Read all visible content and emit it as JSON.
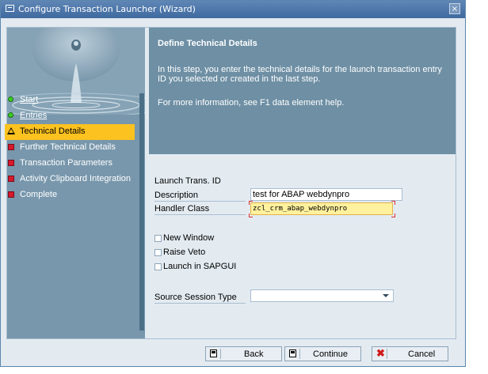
{
  "window": {
    "title": "Configure Transaction Launcher (Wizard)",
    "close_symbol": "×"
  },
  "nav": {
    "items": [
      {
        "label": "Start",
        "icon": "green-dot-icon",
        "state": "done"
      },
      {
        "label": "Entries",
        "icon": "green-dot-icon",
        "state": "done"
      },
      {
        "label": "Technical Details",
        "icon": "warning-triangle-icon",
        "state": "current"
      },
      {
        "label": "Further Technical Details",
        "icon": "red-square-icon",
        "state": "pending"
      },
      {
        "label": "Transaction Parameters",
        "icon": "red-square-icon",
        "state": "pending"
      },
      {
        "label": "Activity Clipboard Integration",
        "icon": "red-square-icon",
        "state": "pending"
      },
      {
        "label": "Complete",
        "icon": "red-square-icon",
        "state": "pending"
      }
    ]
  },
  "info": {
    "title": "Define Technical Details",
    "text": "In this step, you enter the technical details for the launch transaction entry ID you selected or created in the last step.",
    "help": "For more information, see F1 data element help."
  },
  "form": {
    "launch_id_label": "Launch Trans. ID",
    "description_label": "Description",
    "description_value": "test for ABAP webdynpro",
    "handler_label": "Handler Class",
    "handler_value": "zcl_crm_abap_webdynpro",
    "new_window_label": "New Window",
    "raise_veto_label": "Raise Veto",
    "launch_sapgui_label": "Launch in SAPGUI",
    "source_session_label": "Source Session Type",
    "source_session_value": ""
  },
  "buttons": {
    "back": "Back",
    "continue": "Continue",
    "cancel": "Cancel"
  },
  "colors": {
    "titlebar": "#4a74a6",
    "active_nav": "#fcc21f",
    "info_panel": "#6e8fa4",
    "nav_panel": "#7897ac"
  }
}
